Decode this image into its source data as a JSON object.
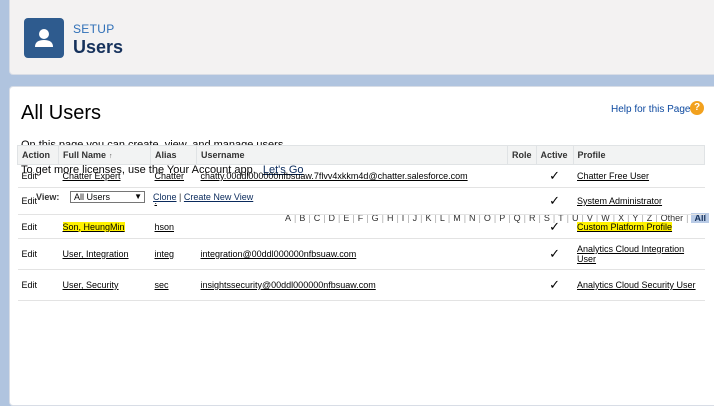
{
  "header": {
    "setup_label": "SETUP",
    "title": "Users"
  },
  "main": {
    "title": "All Users",
    "help_link": "Help for this Page",
    "help_icon": "?",
    "description": "On this page you can create, view, and manage users.",
    "licenses_text": "To get more licenses, use the Your Account app.",
    "lets_go": "Let's Go"
  },
  "view": {
    "label": "View:",
    "selected": "All Users",
    "clone": "Clone",
    "divider": "|",
    "create_new": "Create New View"
  },
  "alphabet": [
    "A",
    "B",
    "C",
    "D",
    "E",
    "F",
    "G",
    "H",
    "I",
    "J",
    "K",
    "L",
    "M",
    "N",
    "O",
    "P",
    "Q",
    "R",
    "S",
    "T",
    "U",
    "V",
    "W",
    "X",
    "Y",
    "Z",
    "Other",
    "All"
  ],
  "table": {
    "columns": [
      "Action",
      "Full Name",
      "Alias",
      "Username",
      "Role",
      "Active",
      "Profile"
    ],
    "sort_icon": "↑",
    "active_mark": "✓",
    "rows": [
      {
        "action": "Edit",
        "full_name": "Chatter Expert",
        "alias": "Chatter",
        "username": "chatty.00ddl000000nfbsuaw.7flvv4xkkm4d@chatter.salesforce.com",
        "role": "",
        "profile": "Chatter Free User"
      },
      {
        "action": "Edit",
        "full_name": "",
        "alias": ".",
        "username": "",
        "role": "",
        "profile": "System Administrator"
      },
      {
        "action": "Edit",
        "full_name": "Son, HeungMin",
        "alias": "hson",
        "username": "",
        "role": "",
        "profile": "Custom Platform Profile"
      },
      {
        "action": "Edit",
        "full_name": "User, Integration",
        "alias": "integ",
        "username": "integration@00ddl000000nfbsuaw.com",
        "role": "",
        "profile": "Analytics Cloud Integration User"
      },
      {
        "action": "Edit",
        "full_name": "User, Security",
        "alias": "sec",
        "username": "insightssecurity@00ddl000000nfbsuaw.com",
        "role": "",
        "profile": "Analytics Cloud Security User"
      }
    ]
  },
  "colors": {
    "header_icon": "#2e5b8e",
    "highlight": "#fff200",
    "background": "#b0c4df"
  }
}
